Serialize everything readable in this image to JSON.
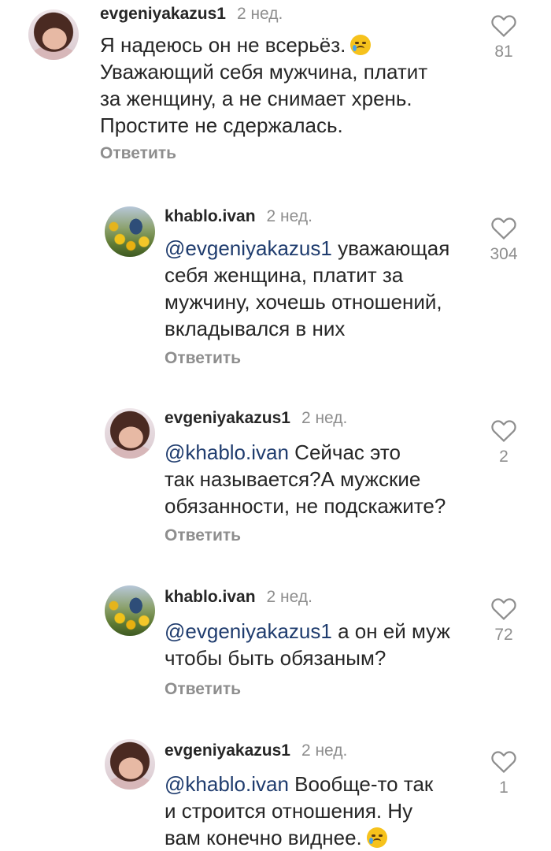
{
  "comments": [
    {
      "username": "evgeniyakazus1",
      "time": "2 нед.",
      "mention": "",
      "lines": [
        "Я надеюсь  он  не всерьёз.",
        "Уважающий  себя  мужчина, платит",
        "за женщину, а не снимает  хрень.",
        "Простите  не сдержалась."
      ],
      "emoji_line": 0,
      "reply_label": "Ответить",
      "likes": "81",
      "avatar": "woman-avatar"
    },
    {
      "username": "khablo.ivan",
      "time": "2 нед.",
      "mention": "@evgeniyakazus1",
      "lines": [
        " уважающая",
        "себя женщина, платит за",
        "мужчину, хочешь отношений,",
        "вкладывался в них"
      ],
      "reply_label": "Ответить",
      "likes": "304",
      "avatar": "man-sunflowers-avatar"
    },
    {
      "username": "evgeniyakazus1",
      "time": "2 нед.",
      "mention": "@khablo.ivan",
      "lines": [
        " Сейчас  это",
        "так  называется?А мужские",
        "обязанности, не подскажите?"
      ],
      "reply_label": "Ответить",
      "likes": "2",
      "avatar": "woman-avatar"
    },
    {
      "username": "khablo.ivan",
      "time": "2 нед.",
      "mention": "@evgeniyakazus1",
      "lines": [
        " а он ей муж",
        "чтобы быть обязаным?"
      ],
      "reply_label": "Ответить",
      "likes": "72",
      "avatar": "man-sunflowers-avatar"
    },
    {
      "username": "evgeniyakazus1",
      "time": "2 нед.",
      "mention": "@khablo.ivan",
      "lines": [
        " Вообще-то  так",
        "и строится  отношения. Ну",
        "вам  конечно  виднее."
      ],
      "emoji_line": 2,
      "reply_label": "",
      "likes": "1",
      "avatar": "woman-avatar"
    }
  ],
  "colors": {
    "text": "#262626",
    "muted": "#8e8e8e",
    "mention": "#1f3c6e"
  },
  "icons": {
    "like": "heart-outline-icon",
    "emoji": "crying-face-emoji"
  }
}
